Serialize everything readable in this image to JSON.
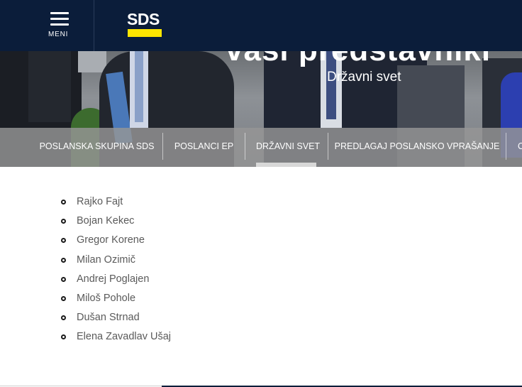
{
  "header": {
    "menu_label": "MENI",
    "logo_text": "SDS"
  },
  "hero": {
    "title": "vaši predstavniki",
    "subtitle": "Državni svet"
  },
  "nav": {
    "items": [
      {
        "label": "POSLANSKA SKUPINA SDS"
      },
      {
        "label": "POSLANCI EP"
      },
      {
        "label": "DRŽAVNI SVET"
      },
      {
        "label": "PREDLAGAJ POSLANSKO VPRAŠANJE"
      },
      {
        "label": "O"
      }
    ],
    "active_index": 2
  },
  "members": [
    "Rajko Fajt",
    "Bojan Kekec",
    "Gregor Korene",
    "Milan Ozimič",
    "Andrej Poglajen",
    "Miloš Pohole",
    "Dušan Strnad",
    "Elena Zavadlav Ušaj"
  ],
  "colors": {
    "header_bg": "#0b1d3a",
    "logo_accent": "#ffe600",
    "nav_bg": "#969696",
    "text": "#5a5a5a"
  }
}
